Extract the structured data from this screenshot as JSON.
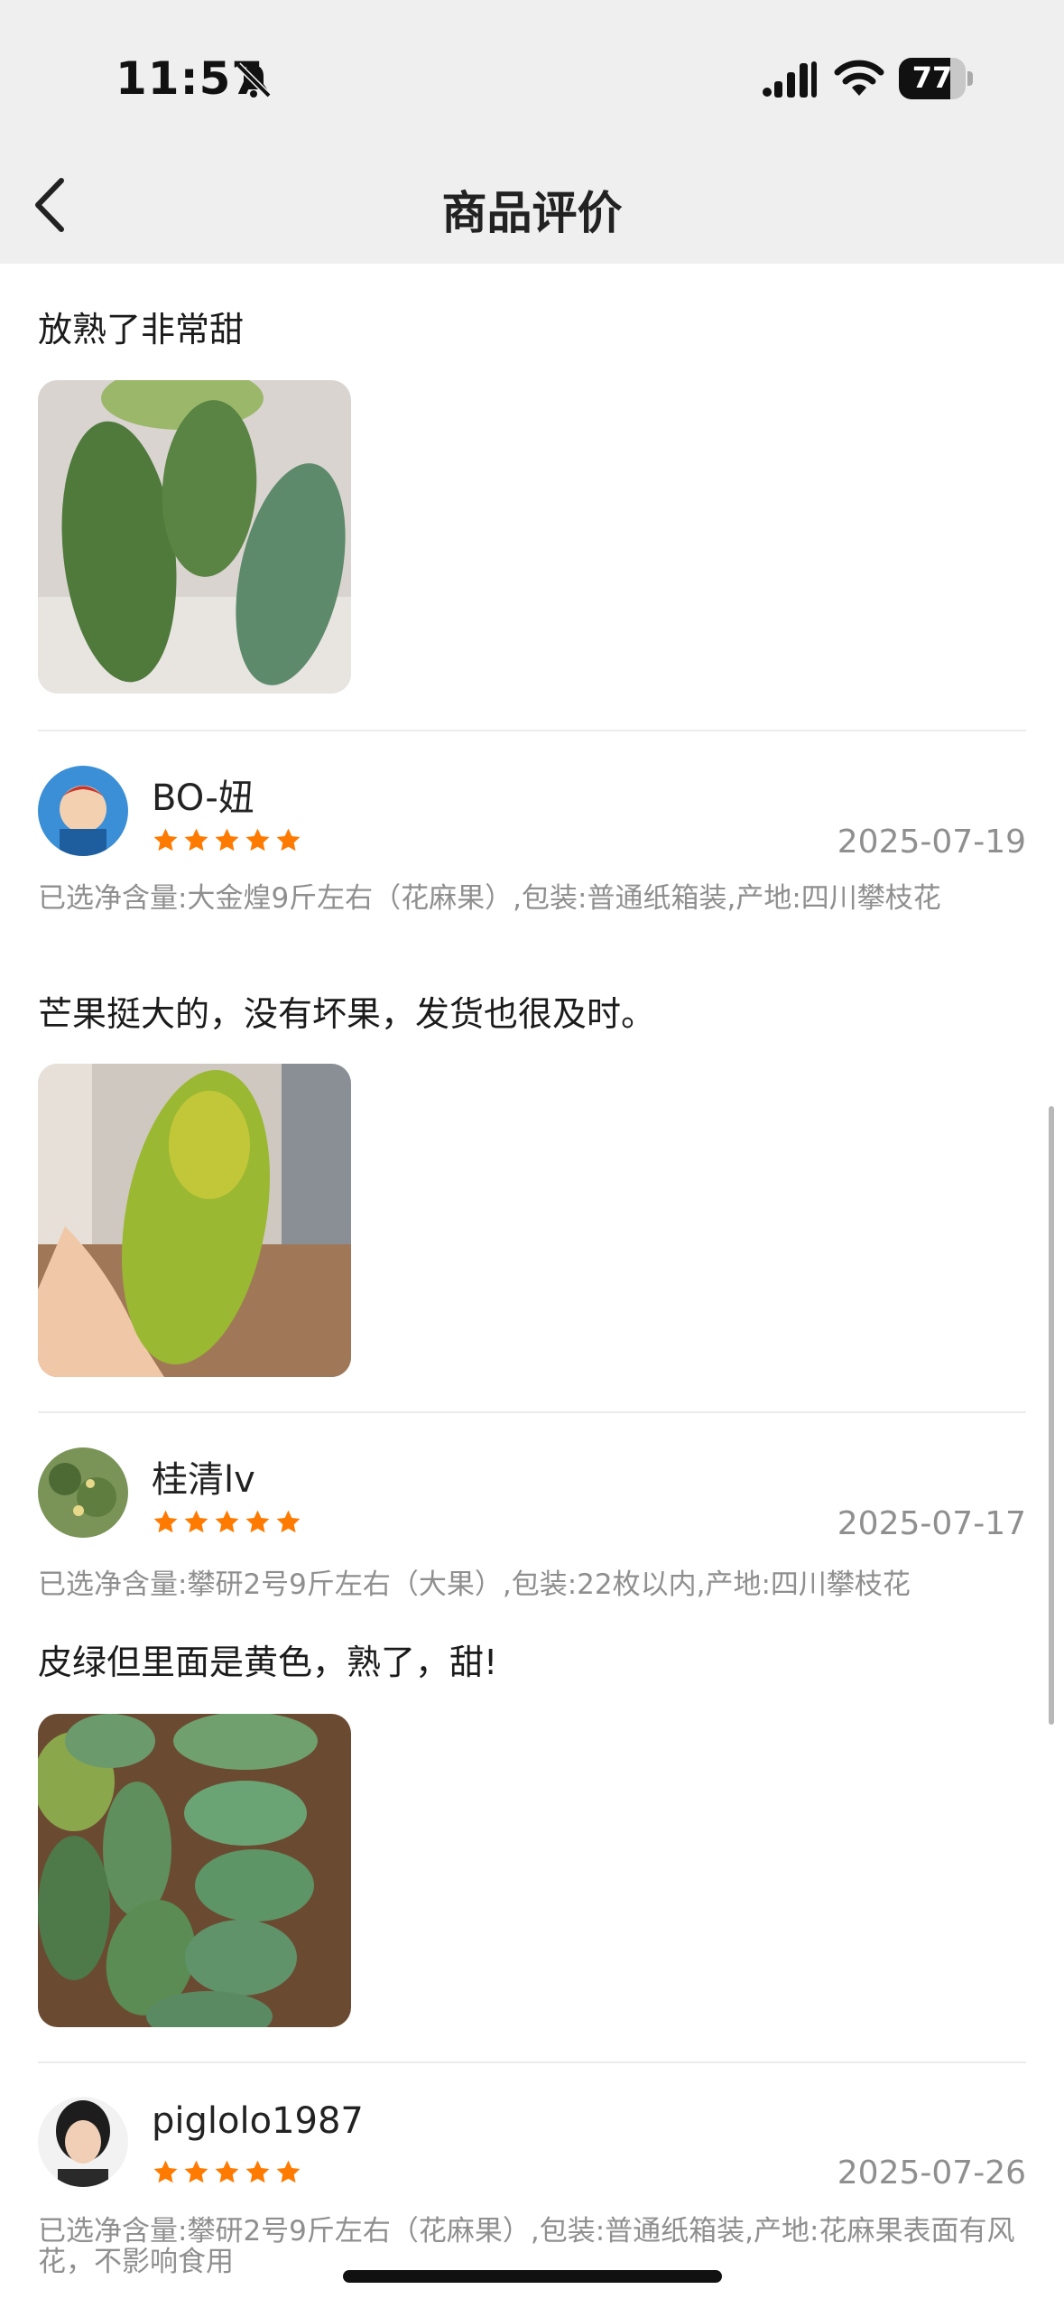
{
  "status_bar": {
    "time": "11:57",
    "battery": "77"
  },
  "nav": {
    "title": "商品评价"
  },
  "first_review_tail": {
    "text": "放熟了非常甜"
  },
  "reviews": [
    {
      "username": "BO-妞",
      "rating": 5,
      "date": "2025-07-19",
      "spec": "已选净含量:大金煌9斤左右（花麻果）,包装:普通纸箱装,产地:四川攀枝花",
      "text": "芒果挺大的，没有坏果，发货也很及时。"
    },
    {
      "username": "桂清lv",
      "rating": 5,
      "date": "2025-07-17",
      "spec": "已选净含量:攀研2号9斤左右（大果）,包装:22枚以内,产地:四川攀枝花",
      "text": "皮绿但里面是黄色，熟了，甜!"
    },
    {
      "username": "piglolo1987",
      "rating": 5,
      "date": "2025-07-26",
      "spec": "已选净含量:攀研2号9斤左右（花麻果）,包装:普通纸箱装,产地:花麻果表面有风花，不影响食用"
    }
  ],
  "colors": {
    "star": "#ff7a00",
    "meta": "#8f8f8f",
    "divider": "#ececec",
    "header_bg": "#efefef"
  }
}
